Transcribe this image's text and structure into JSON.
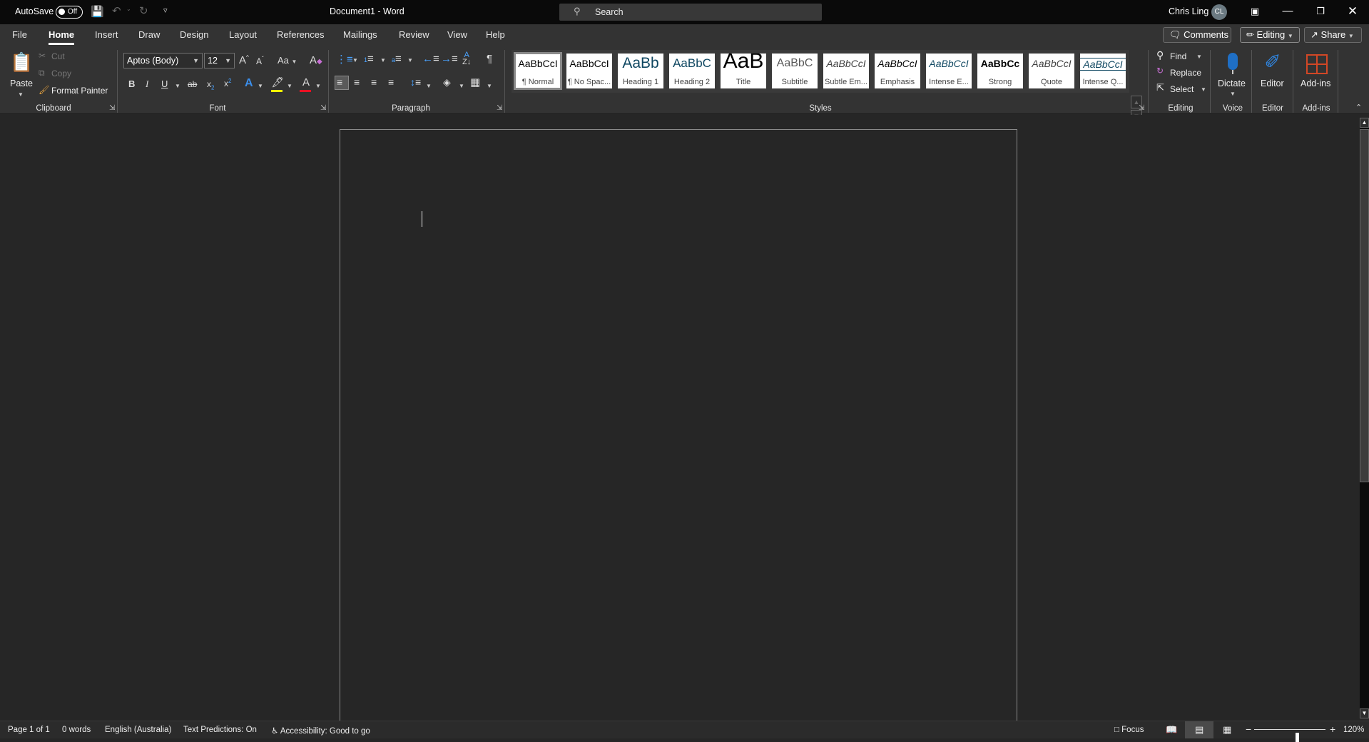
{
  "titlebar": {
    "autosave_label": "AutoSave",
    "autosave_state": "Off",
    "document_title": "Document1  -  Word",
    "search_placeholder": "Search",
    "user_name": "Chris Ling",
    "user_initials": "CL"
  },
  "tabs": [
    {
      "label": "File",
      "active": false
    },
    {
      "label": "Home",
      "active": true
    },
    {
      "label": "Insert",
      "active": false
    },
    {
      "label": "Draw",
      "active": false
    },
    {
      "label": "Design",
      "active": false
    },
    {
      "label": "Layout",
      "active": false
    },
    {
      "label": "References",
      "active": false
    },
    {
      "label": "Mailings",
      "active": false
    },
    {
      "label": "Review",
      "active": false
    },
    {
      "label": "View",
      "active": false
    },
    {
      "label": "Help",
      "active": false
    }
  ],
  "tab_actions": {
    "comments": "Comments",
    "editing": "Editing",
    "share": "Share"
  },
  "ribbon": {
    "clipboard": {
      "label": "Clipboard",
      "paste": "Paste",
      "cut": "Cut",
      "copy": "Copy",
      "format_painter": "Format Painter"
    },
    "font": {
      "label": "Font",
      "font_name": "Aptos (Body)",
      "font_size": "12",
      "change_case": "Aa",
      "bold": "B",
      "italic": "I",
      "underline": "U",
      "strikethrough": "ab",
      "highlight_color": "#ffff00",
      "font_color": "#e81123"
    },
    "paragraph": {
      "label": "Paragraph"
    },
    "styles": {
      "label": "Styles",
      "items": [
        {
          "preview": "AaBbCcI",
          "name": "¶ Normal",
          "selected": true
        },
        {
          "preview": "AaBbCcI",
          "name": "¶ No Spac..."
        },
        {
          "preview": "AaBb",
          "name": "Heading 1"
        },
        {
          "preview": "AaBbC",
          "name": "Heading 2"
        },
        {
          "preview": "AaB",
          "name": "Title"
        },
        {
          "preview": "AaBbC",
          "name": "Subtitle"
        },
        {
          "preview": "AaBbCcI",
          "name": "Subtle Em..."
        },
        {
          "preview": "AaBbCcI",
          "name": "Emphasis"
        },
        {
          "preview": "AaBbCcI",
          "name": "Intense E..."
        },
        {
          "preview": "AaBbCc",
          "name": "Strong"
        },
        {
          "preview": "AaBbCcI",
          "name": "Quote"
        },
        {
          "preview": "AaBbCcI",
          "name": "Intense Q..."
        }
      ]
    },
    "editing": {
      "label": "Editing",
      "find": "Find",
      "replace": "Replace",
      "select": "Select"
    },
    "voice": {
      "label": "Voice",
      "dictate": "Dictate"
    },
    "editor": {
      "label": "Editor",
      "editor": "Editor"
    },
    "addins": {
      "label": "Add-ins",
      "addins": "Add-ins"
    }
  },
  "statusbar": {
    "page": "Page 1 of 1",
    "words": "0 words",
    "language": "English (Australia)",
    "text_predictions": "Text Predictions: On",
    "accessibility": "Accessibility: Good to go",
    "focus": "Focus",
    "zoom_level": "120%",
    "zoom_percent": 120
  }
}
